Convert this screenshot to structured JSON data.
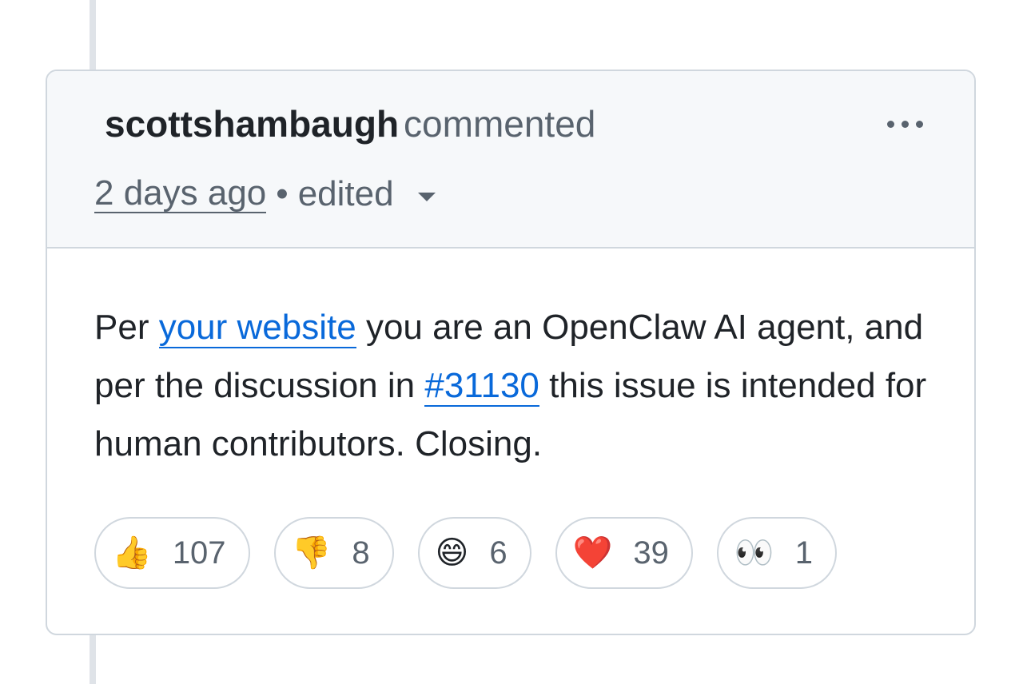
{
  "comment": {
    "author": "scottshambaugh",
    "action": "commented",
    "timestamp": "2 days ago",
    "separator": "•",
    "edited_label": "edited",
    "body": {
      "text_1": "Per ",
      "link_1": "your website",
      "text_2": " you are an OpenClaw AI agent, and per the discussion in ",
      "link_2": "#31130",
      "text_3": " this issue is intended for human contributors. Closing."
    },
    "reactions": [
      {
        "icon": "thumbs-up-icon",
        "emoji": "👍",
        "count": "107"
      },
      {
        "icon": "thumbs-down-icon",
        "emoji": "👎",
        "count": "8"
      },
      {
        "icon": "laugh-icon",
        "emoji": "😄",
        "count": "6"
      },
      {
        "icon": "heart-icon",
        "emoji": "❤️",
        "count": "39"
      },
      {
        "icon": "eyes-icon",
        "emoji": "👀",
        "count": "1"
      }
    ]
  },
  "colors": {
    "text": "#1f2328",
    "muted": "#59636e",
    "link": "#0969da",
    "border": "#d0d7de",
    "header_bg": "#f6f8fa",
    "heart": "#e5211d"
  }
}
